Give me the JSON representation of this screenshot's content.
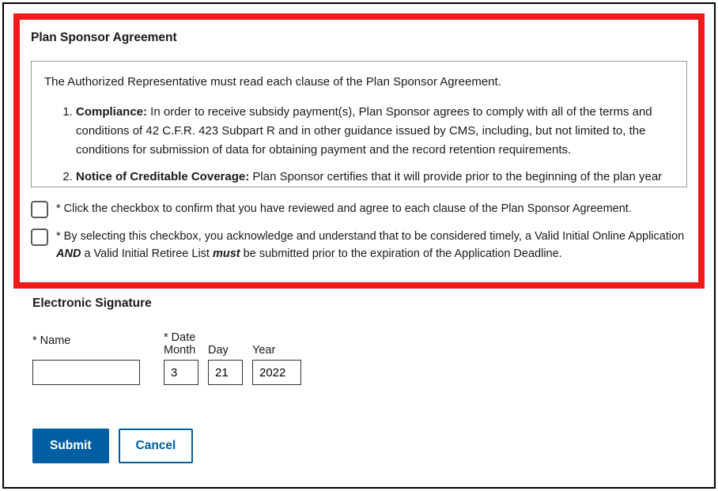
{
  "agreement": {
    "title": "Plan Sponsor Agreement",
    "intro": "The Authorized Representative must read each clause of the Plan Sponsor Agreement.",
    "clauses": [
      {
        "term": "Compliance:",
        "text": " In order to receive subsidy payment(s), Plan Sponsor agrees to comply with all of the terms and conditions of 42 C.F.R. 423 Subpart R and in other guidance issued by CMS, including, but not limited to, the conditions for submission of data for obtaining payment and the record retention requirements."
      },
      {
        "term": "Notice of Creditable Coverage:",
        "text": " Plan Sponsor certifies that it will provide prior to the beginning of the plan year"
      }
    ],
    "checkbox1": "* Click the checkbox to confirm that you have reviewed and agree to each clause of the Plan Sponsor Agreement.",
    "checkbox2_prefix": "* By selecting this checkbox, you acknowledge and understand that to be considered timely, a Valid Initial Online Application ",
    "checkbox2_and": "AND",
    "checkbox2_mid": " a Valid Initial Retiree List ",
    "checkbox2_must": "must",
    "checkbox2_suffix": " be submitted prior to the expiration of the Application Deadline."
  },
  "signature": {
    "title": "Electronic Signature",
    "name_label": "* Name",
    "name_value": "",
    "date_label": "* Date",
    "month_label": "Month",
    "day_label": "Day",
    "year_label": "Year",
    "month_value": "3",
    "day_value": "21",
    "year_value": "2022"
  },
  "buttons": {
    "submit": "Submit",
    "cancel": "Cancel"
  }
}
